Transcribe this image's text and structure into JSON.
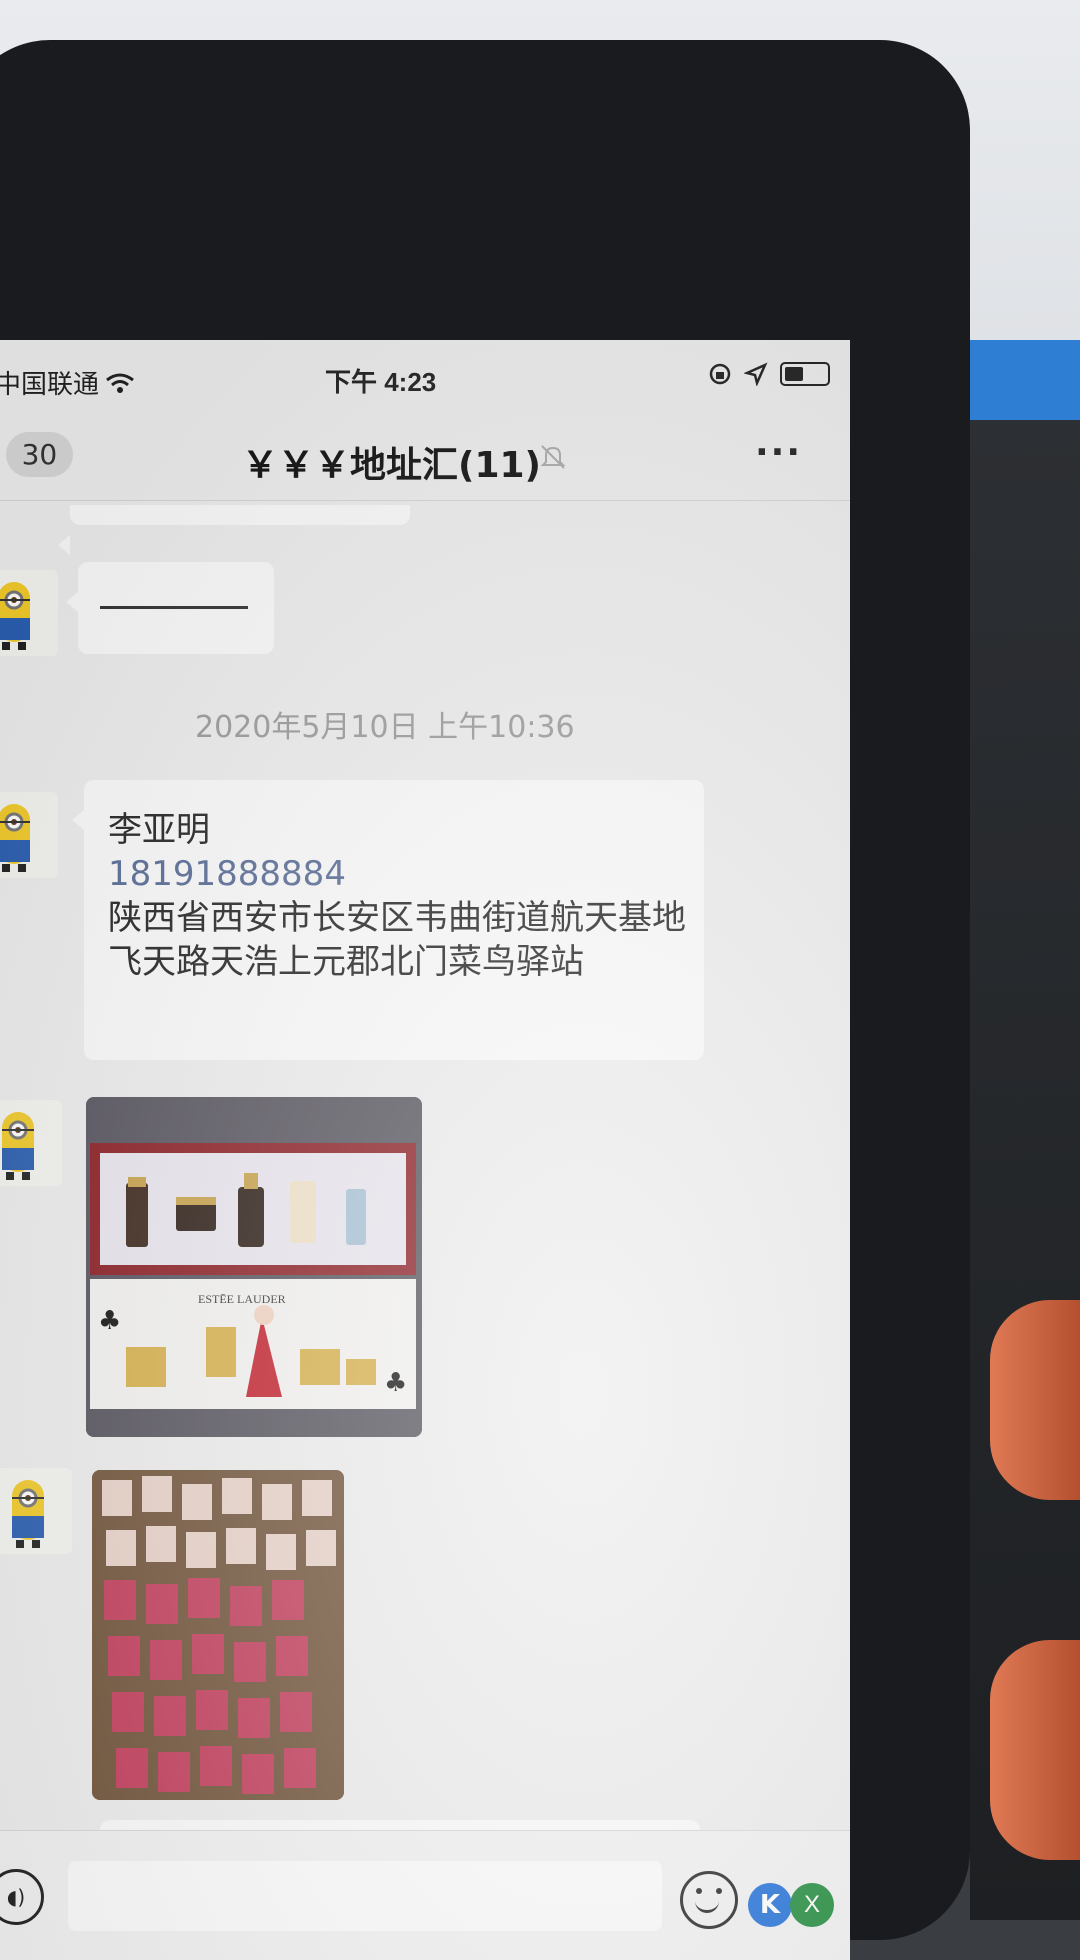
{
  "status_bar": {
    "carrier": "中国联通",
    "time": "下午 4:23"
  },
  "nav": {
    "back_count": "30",
    "title": "￥￥￥地址汇(11)",
    "more": "···"
  },
  "messages": {
    "timestamp": "2020年5月10日 上午10:36",
    "contact_name": "李亚明",
    "contact_phone": "18191888884",
    "contact_address": "陕西省西安市长安区韦曲街道航天基地飞天路天浩上元郡北门菜鸟驿站",
    "product_brand": "ESTĒE LAUDER"
  },
  "input_bar": {
    "float_k": "K",
    "float_x": "X"
  },
  "colors": {
    "link": "#576b95",
    "bubble": "#fafafa",
    "background": "#ededed"
  }
}
